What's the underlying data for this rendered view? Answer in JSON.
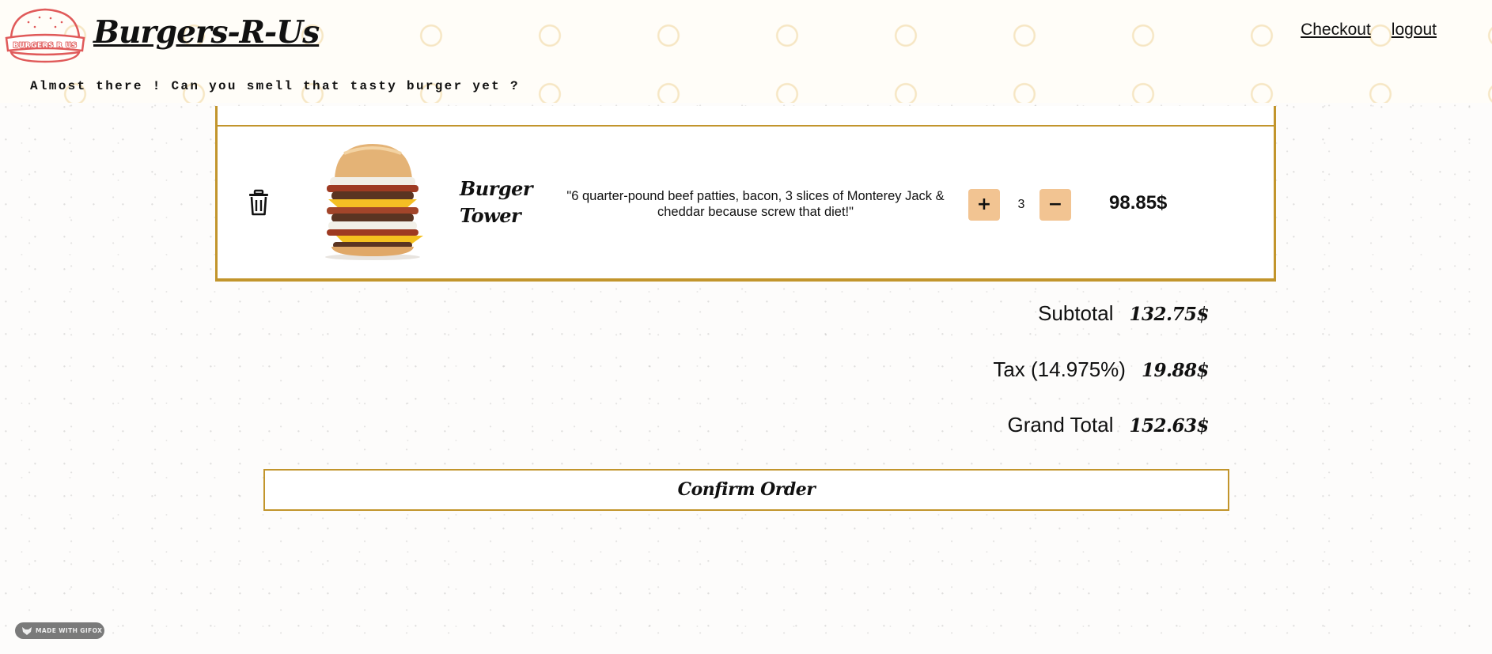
{
  "header": {
    "brand": "Burgers-R-Us",
    "tagline": "Almost there ! Can you smell that tasty burger yet ?",
    "logo_text": "BURGERS R US",
    "nav": {
      "checkout": "Checkout",
      "logout": "logout"
    }
  },
  "cart": {
    "items": [
      {
        "name": "Burger Tower",
        "description": "\"6 quarter-pound beef patties, bacon, 3 slices of Monterey Jack & cheddar because screw that diet!\"",
        "quantity": "3",
        "price": "98.85$",
        "plus_label": "+",
        "minus_label": "−"
      }
    ]
  },
  "totals": {
    "subtotal_label": "Subtotal",
    "subtotal_value": "132.75$",
    "tax_label": "Tax (14.975%)",
    "tax_value": "19.88$",
    "grand_label": "Grand Total",
    "grand_value": "152.63$"
  },
  "confirm_label": "Confirm Order",
  "badge": {
    "text": "MADE WITH GIFOX"
  },
  "colors": {
    "accent_gold": "#c2952c",
    "qty_button": "#f2c492",
    "header_pattern": "#eccb85",
    "logo_red": "#e05a5a"
  }
}
